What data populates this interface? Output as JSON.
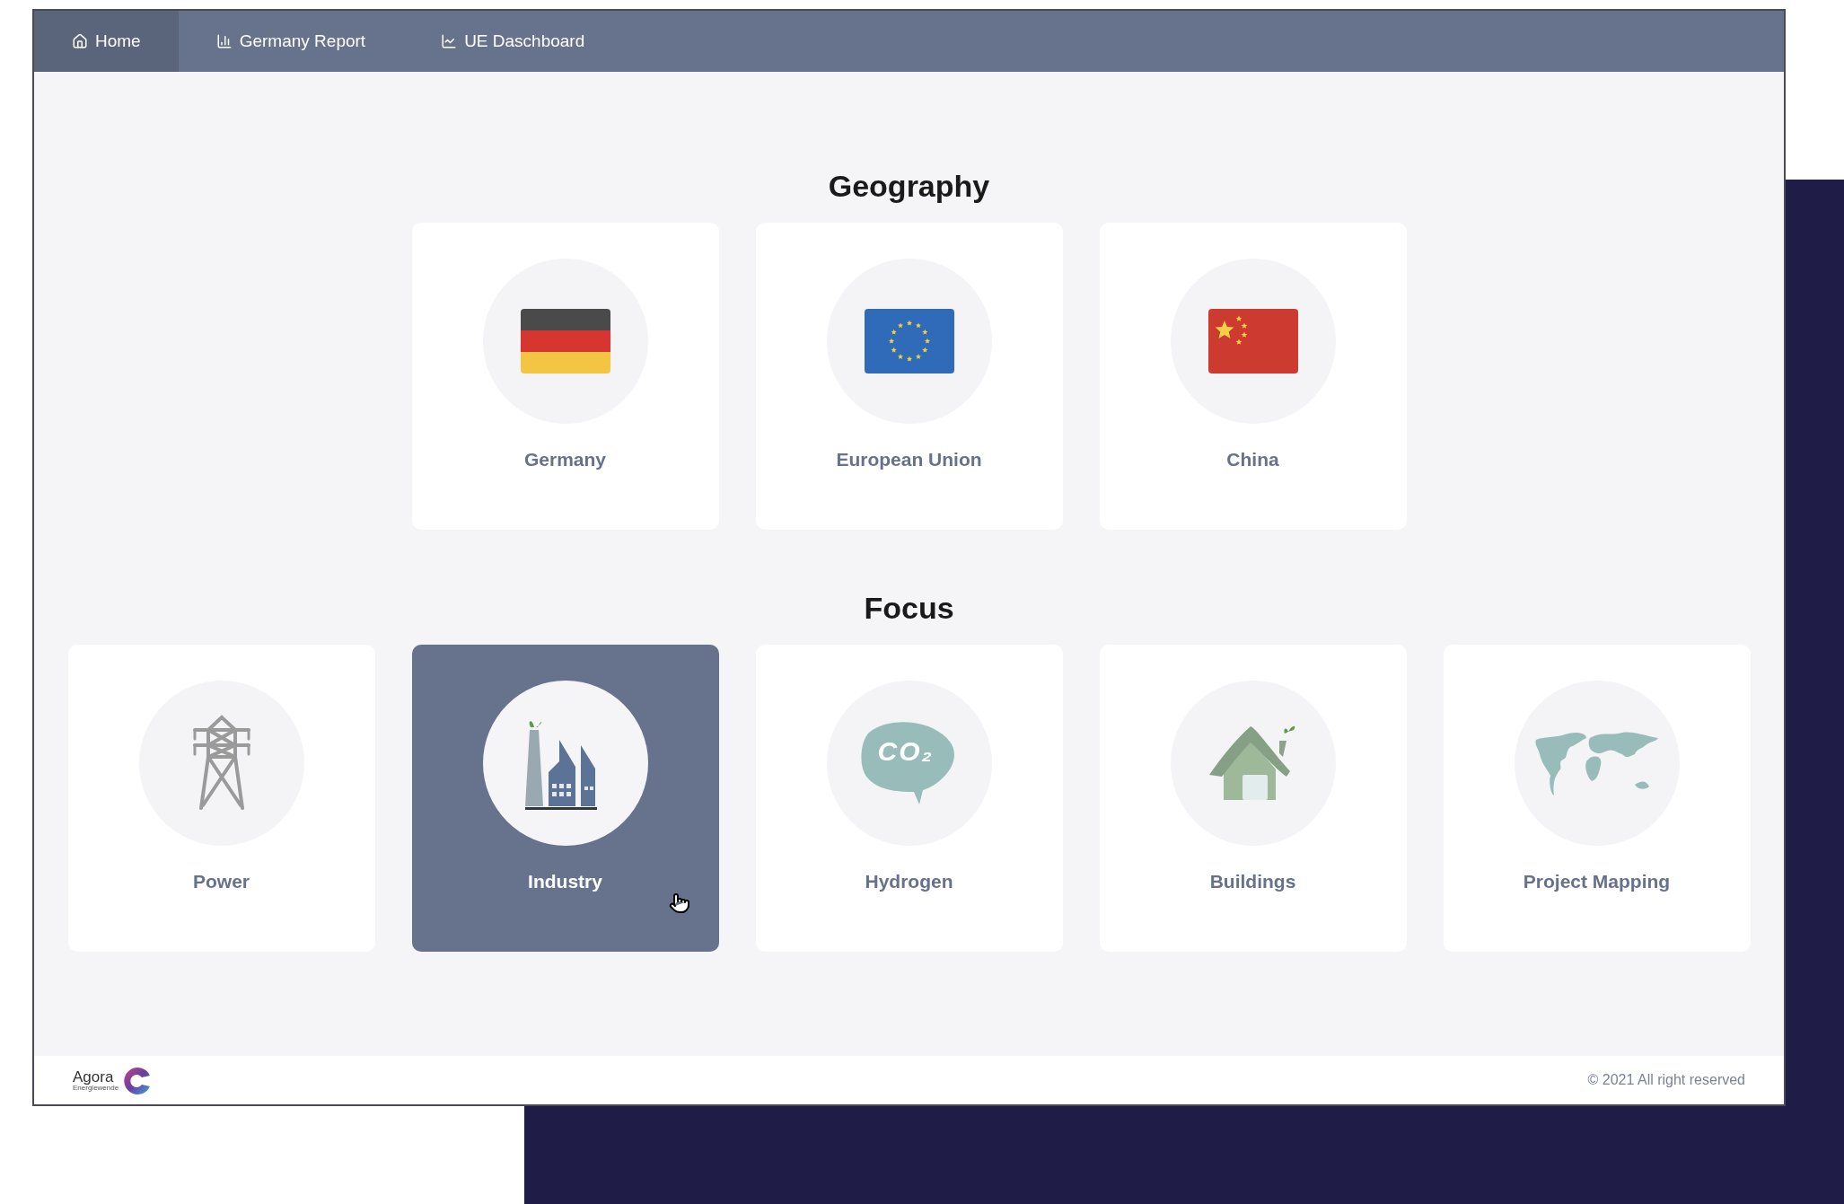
{
  "nav": {
    "tabs": [
      {
        "label": "Home",
        "kind": "home",
        "selected": true
      },
      {
        "label": "Germany Report",
        "kind": "bars",
        "selected": false
      },
      {
        "label": "UE Daschboard",
        "kind": "line",
        "selected": false
      }
    ]
  },
  "sections": [
    {
      "title": "Geography",
      "cards": [
        {
          "label": "Germany",
          "kind": "flag-de",
          "selected": false
        },
        {
          "label": "European Union",
          "kind": "flag-eu",
          "selected": false
        },
        {
          "label": "China",
          "kind": "flag-cn",
          "selected": false
        }
      ]
    },
    {
      "title": "Focus",
      "cards": [
        {
          "label": "Power",
          "kind": "pylon",
          "selected": false
        },
        {
          "label": "Industry",
          "kind": "factory",
          "selected": true
        },
        {
          "label": "Hydrogen",
          "kind": "co2",
          "icon_text": "CO₂",
          "selected": false
        },
        {
          "label": "Buildings",
          "kind": "house",
          "selected": false
        },
        {
          "label": "Project Mapping",
          "kind": "map",
          "selected": false
        }
      ]
    }
  ],
  "footer": {
    "logo_name": "Agora",
    "logo_subtitle": "Energiewende",
    "copyright": "© 2021 All right reserved"
  }
}
